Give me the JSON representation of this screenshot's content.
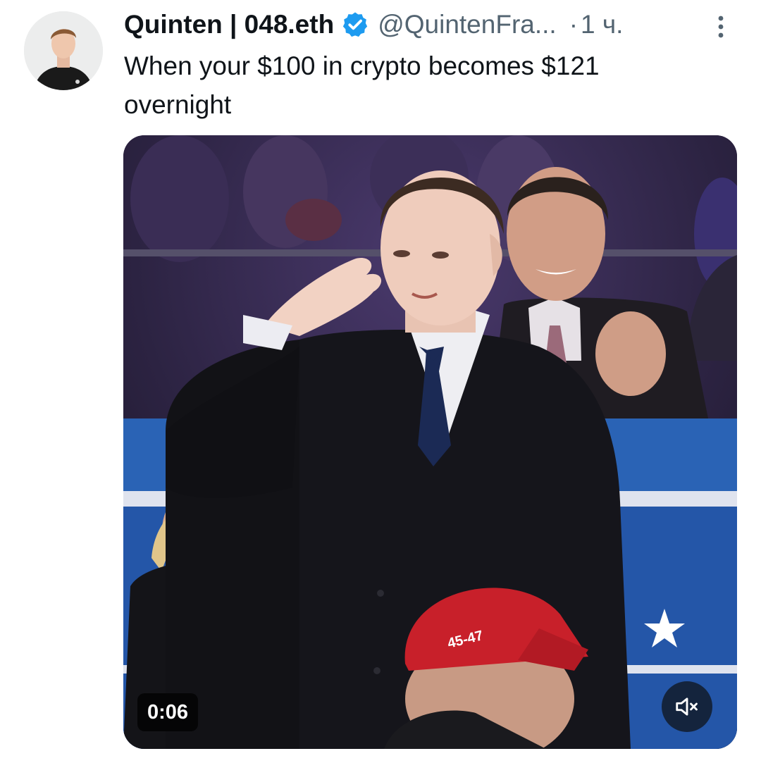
{
  "tweet": {
    "display_name": "Quinten | 048.eth",
    "handle": "@QuintenFra...",
    "separator": "·",
    "time": "1 ч.",
    "text": "When your $100 in crypto becomes $121\novernight",
    "verified": true,
    "icons": {
      "verified": "verified-badge-icon",
      "more": "more-vertical-icon",
      "mute": "volume-muted-icon"
    }
  },
  "video": {
    "duration_label": "0:06",
    "muted": true
  },
  "colors": {
    "verified_blue": "#1d9bf0",
    "text_primary": "#0f1419",
    "text_secondary": "#536471",
    "cap_red": "#c8202a",
    "panel_blue": "#2a63b5"
  }
}
